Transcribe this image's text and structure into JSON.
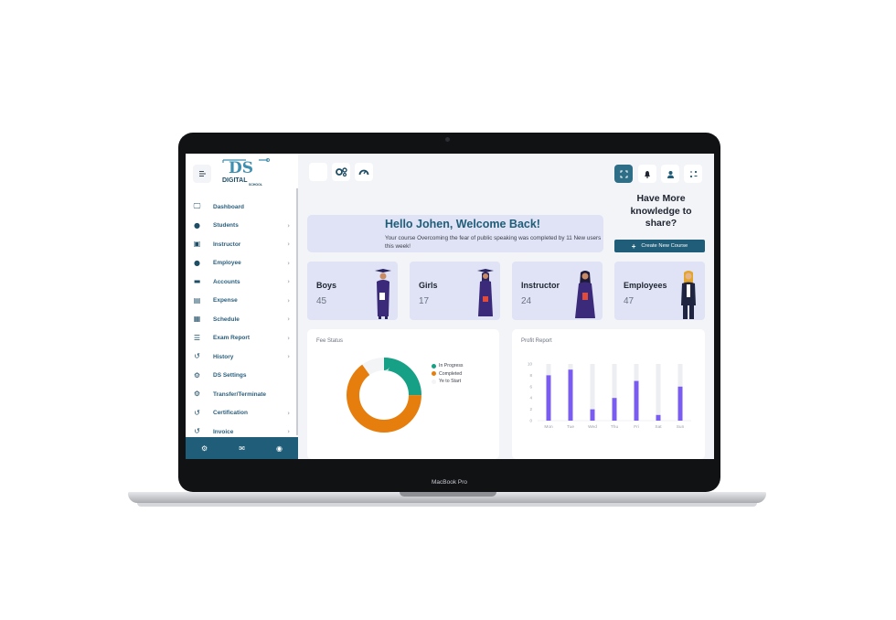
{
  "device": {
    "model": "MacBook Pro"
  },
  "logo": {
    "brand": "DS",
    "name": "DIGITAL",
    "sub": "SCHOOL"
  },
  "sidebar": {
    "items": [
      {
        "label": "Dashboard",
        "icon": "monitor-icon",
        "has_children": false
      },
      {
        "label": "Students",
        "icon": "user-icon",
        "has_children": true
      },
      {
        "label": "Instructor",
        "icon": "presentation-icon",
        "has_children": true
      },
      {
        "label": "Employee",
        "icon": "user-icon",
        "has_children": true
      },
      {
        "label": "Accounts",
        "icon": "wallet-icon",
        "has_children": true
      },
      {
        "label": "Expense",
        "icon": "file-icon",
        "has_children": true
      },
      {
        "label": "Schedule",
        "icon": "calendar-icon",
        "has_children": true
      },
      {
        "label": "Exam Report",
        "icon": "list-icon",
        "has_children": true
      },
      {
        "label": "History",
        "icon": "history-icon",
        "has_children": true
      },
      {
        "label": "DS Settings",
        "icon": "gears-icon",
        "has_children": false
      },
      {
        "label": "Transfer/Terminate",
        "icon": "gears-icon",
        "has_children": false
      },
      {
        "label": "Certification",
        "icon": "history-icon",
        "has_children": true
      },
      {
        "label": "Invoice",
        "icon": "history-icon",
        "has_children": true
      }
    ],
    "footer_icons": [
      "gear-icon",
      "mail-icon",
      "power-icon"
    ]
  },
  "topbar": {
    "left_icons": [
      "blank-icon",
      "gears-icon",
      "speedometer-icon"
    ],
    "right_icons": [
      "fullscreen-icon",
      "bell-icon",
      "user-icon",
      "apps-icon"
    ]
  },
  "welcome": {
    "title": "Hello Johen, Welcome Back!",
    "message": "Your course Overcoming the fear of public speaking was completed by 11 New users this week!"
  },
  "share": {
    "title": "Have More knowledge to share?",
    "button_label": "Create New Course"
  },
  "stats": [
    {
      "label": "Boys",
      "value": "45"
    },
    {
      "label": "Girls",
      "value": "17"
    },
    {
      "label": "Instructor",
      "value": "24"
    },
    {
      "label": "Employees",
      "value": "47"
    }
  ],
  "fee_status": {
    "title": "Fee Status",
    "legend": [
      {
        "label": "In Progress",
        "color": "#16a085"
      },
      {
        "label": "Completed",
        "color": "#e67e0e"
      },
      {
        "label": "Ye to Start",
        "color": "#f3f4f6"
      }
    ]
  },
  "profit_report": {
    "title": "Profit Report"
  },
  "colors": {
    "primary": "#1f5d78",
    "card_bg": "#dfe3f5",
    "bar": "#7b5cf0",
    "bar_track": "#eceef2"
  },
  "chart_data": [
    {
      "type": "pie",
      "title": "Fee Status",
      "labels": [
        "In Progress",
        "Completed",
        "Ye to Start"
      ],
      "values": [
        25,
        65,
        10
      ],
      "colors": [
        "#16a085",
        "#e67e0e",
        "#f3f4f6"
      ],
      "legend": "right"
    },
    {
      "type": "bar",
      "title": "Profit Report",
      "categories": [
        "Mon",
        "Tue",
        "Wed",
        "Thu",
        "Fri",
        "Sat",
        "Sun"
      ],
      "values": [
        8,
        9,
        2,
        4,
        7,
        1,
        6
      ],
      "track_max": 10,
      "ylim": [
        0,
        10
      ],
      "yticks": [
        0,
        2,
        4,
        6,
        8,
        10
      ],
      "grid": true
    }
  ]
}
